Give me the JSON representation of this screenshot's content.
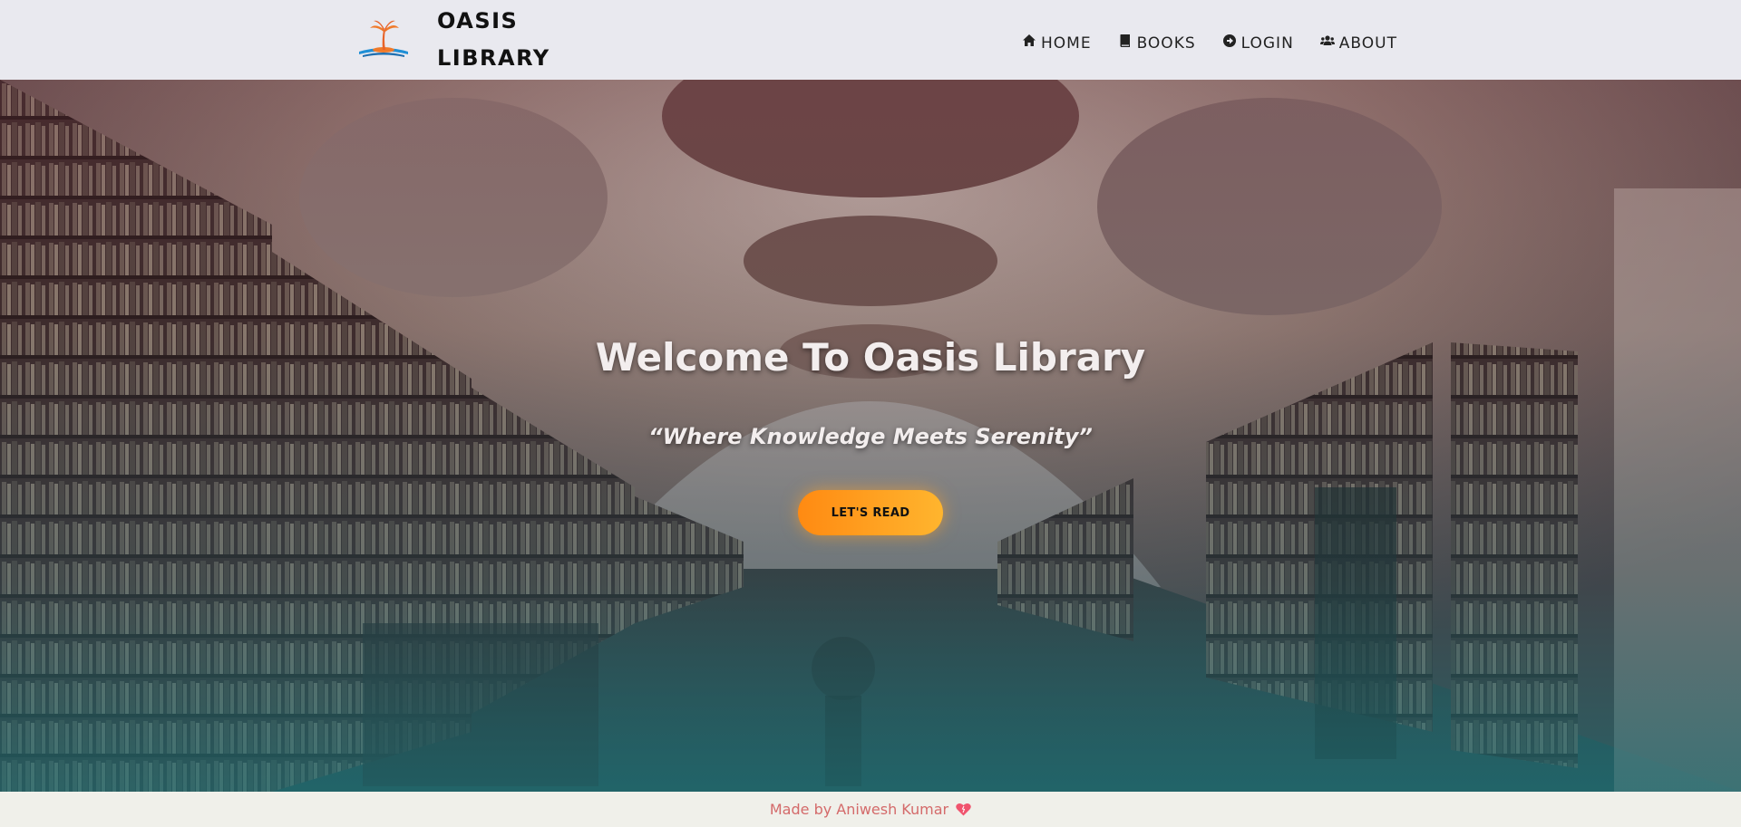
{
  "brand": {
    "line1": "OASIS",
    "line2": "LIBRARY",
    "logo_icon": "palm-island-book-icon"
  },
  "nav": {
    "items": [
      {
        "label": "HOME",
        "icon": "home-icon"
      },
      {
        "label": "BOOKS",
        "icon": "book-icon"
      },
      {
        "label": "LOGIN",
        "icon": "login-icon"
      },
      {
        "label": "ABOUT",
        "icon": "users-icon"
      }
    ]
  },
  "hero": {
    "title": "Welcome To Oasis Library",
    "quote": "“Where Knowledge Meets Serenity”",
    "button_label": "LET'S READ",
    "background": "ornate-library-hall-photo"
  },
  "footer": {
    "text": "Made by Aniwesh Kumar",
    "icon": "heart-icon"
  },
  "colors": {
    "accent": "#ff9a1f",
    "footer_text": "#d46a6a",
    "nav_bg": "#e9e9ef"
  }
}
